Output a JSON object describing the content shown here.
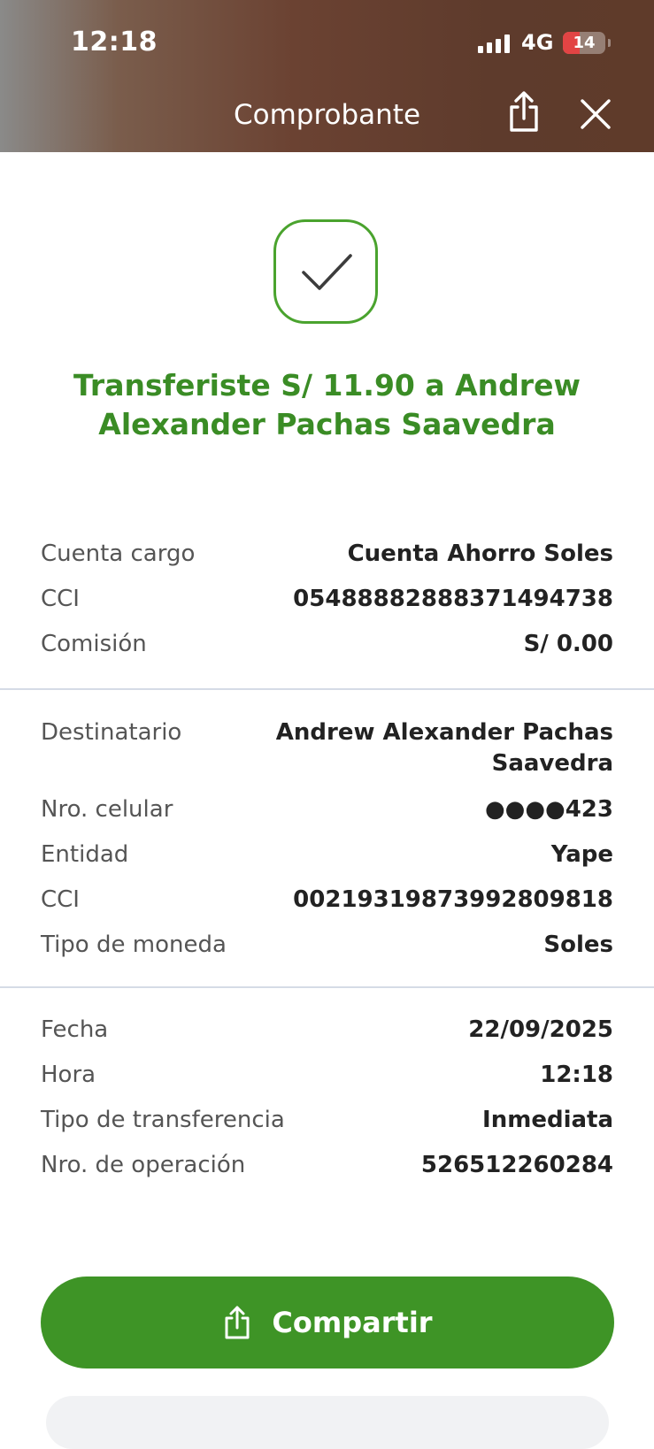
{
  "status_bar": {
    "time": "12:18",
    "network": "4G",
    "battery": "14",
    "battery_level": 0.14
  },
  "header": {
    "title": "Comprobante",
    "share_icon": "share-icon",
    "close_icon": "close-icon"
  },
  "success": {
    "icon": "check-icon",
    "headline": "Transferiste S/ 11.90 a Andrew Alexander Pachas Saavedra"
  },
  "origin": [
    {
      "label": "Cuenta cargo",
      "value": "Cuenta Ahorro Soles"
    },
    {
      "label": "CCI",
      "value": "05488882888371494738"
    },
    {
      "label": "Comisión",
      "value": "S/ 0.00"
    }
  ],
  "recipient": [
    {
      "label": "Destinatario",
      "value_line1": "Andrew Alexander Pachas",
      "value_line2": "Saavedra"
    },
    {
      "label": "Nro. celular",
      "value": "●●●●423"
    },
    {
      "label": "Entidad",
      "value": "Yape"
    },
    {
      "label": "CCI",
      "value": "00219319873992809818"
    },
    {
      "label": "Tipo de moneda",
      "value": "Soles"
    }
  ],
  "details": [
    {
      "label": "Fecha",
      "value": "22/09/2025"
    },
    {
      "label": "Hora",
      "value": "12:18"
    },
    {
      "label": "Tipo de transferencia",
      "value": "Inmediata"
    },
    {
      "label": "Nro. de operación",
      "value": "526512260284"
    }
  ],
  "actions": {
    "share_label": "Compartir",
    "share_icon": "share-icon"
  },
  "colors": {
    "accent_green": "#3e9426",
    "headline_green": "#3a8c25",
    "check_border": "#4aa32e",
    "divider": "#d5dbe6"
  }
}
